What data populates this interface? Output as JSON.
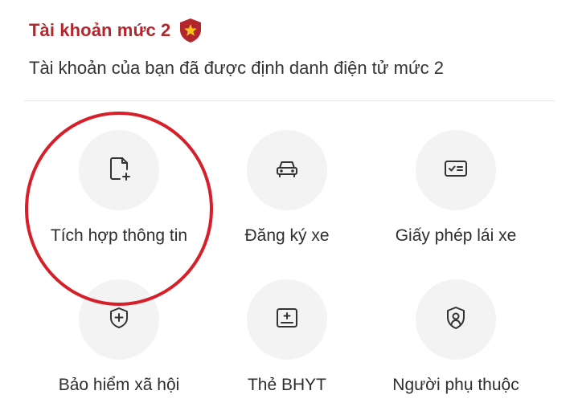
{
  "account": {
    "level_title": "Tài khoản mức 2",
    "description": "Tài khoản của bạn đã được định danh điện tử mức 2",
    "badge_icon": "shield-star-icon",
    "accent_color": "#b3262d"
  },
  "services": [
    {
      "label": "Tích hợp thông tin",
      "icon": "document-plus-icon"
    },
    {
      "label": "Đăng ký xe",
      "icon": "car-icon"
    },
    {
      "label": "Giấy phép lái xe",
      "icon": "license-card-icon"
    },
    {
      "label": "Bảo hiểm xã hội",
      "icon": "shield-plus-icon"
    },
    {
      "label": "Thẻ BHYT",
      "icon": "health-card-icon"
    },
    {
      "label": "Người phụ thuộc",
      "icon": "person-shield-icon"
    }
  ],
  "annotation": {
    "color": "#d71f2a"
  }
}
